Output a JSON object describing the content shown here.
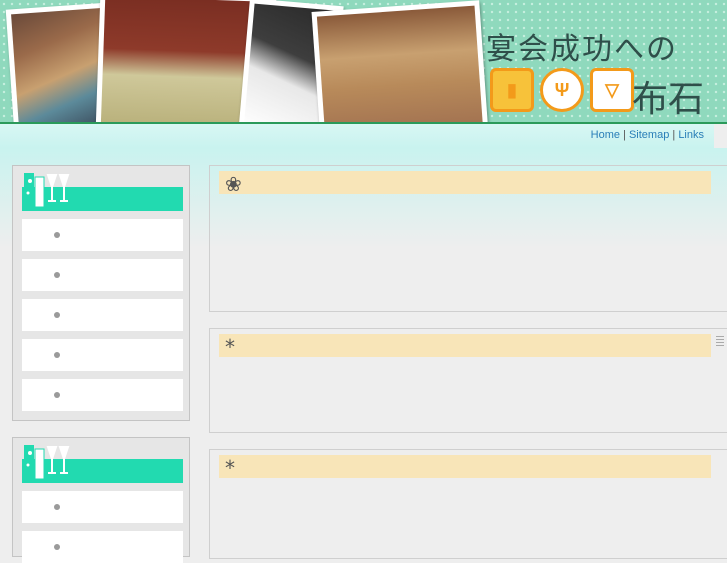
{
  "header": {
    "title_line": "宴会成功への",
    "title_kanji": "布石",
    "icons": [
      "beer-mug-icon",
      "fork-knife-plate-icon",
      "cocktail-glass-icon"
    ]
  },
  "nav": {
    "links": [
      "Home",
      "Sitemap",
      "Links"
    ],
    "separator": "|"
  },
  "content": {
    "panel_marks": [
      "❀",
      "*",
      "*"
    ]
  },
  "colors": {
    "header_bg": "#8fd9bd",
    "side_header": "#22dab0",
    "panel_title": "#f8e5b8",
    "nav_link": "#2a7fb8",
    "title_icon": "#f39a1a"
  }
}
